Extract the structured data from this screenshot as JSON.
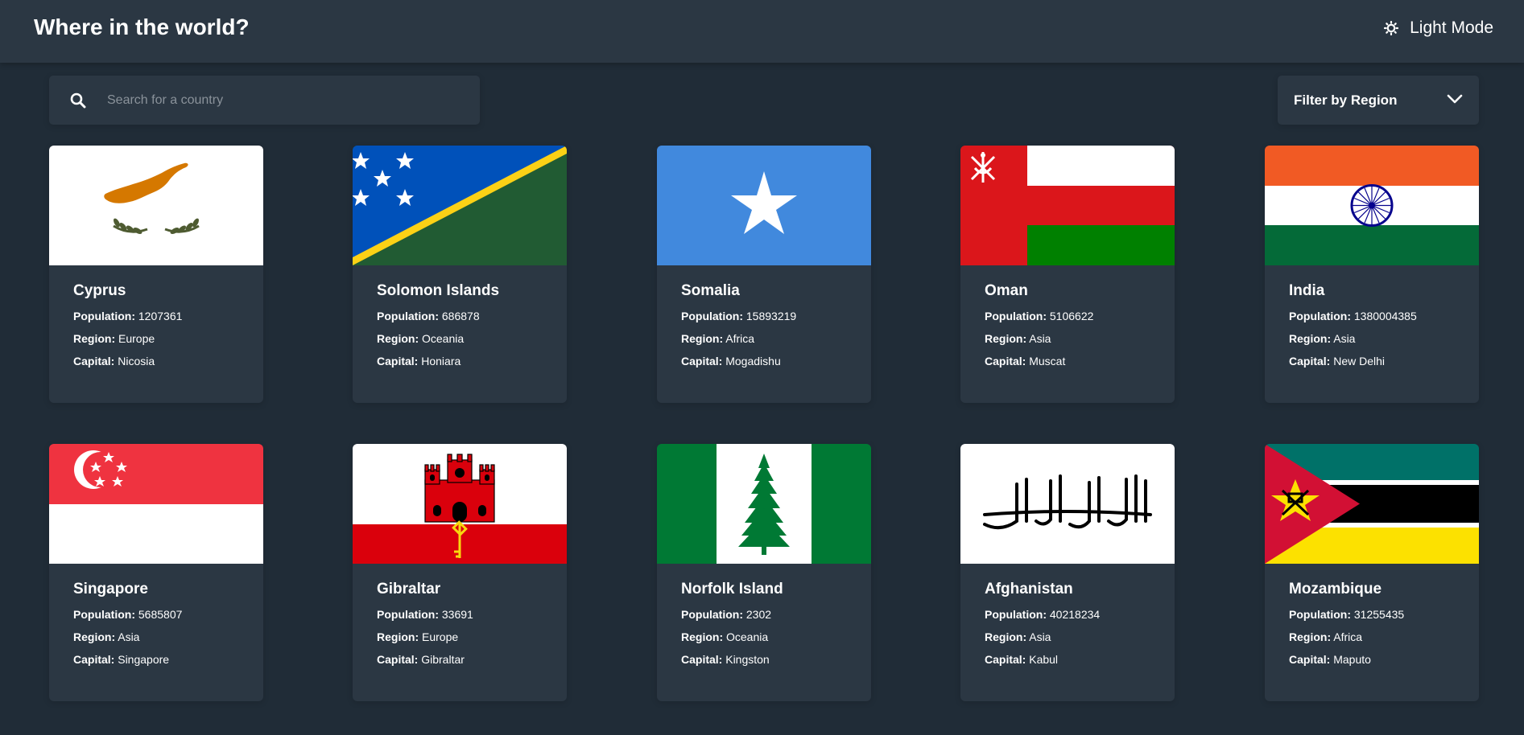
{
  "header": {
    "title": "Where in the world?",
    "theme_label": "Light Mode",
    "theme_icon": "sun-icon"
  },
  "search": {
    "placeholder": "Search for a country",
    "icon": "search-icon"
  },
  "filter": {
    "label": "Filter by Region",
    "icon": "chevron-down-icon"
  },
  "labels": {
    "population": "Population:",
    "region": "Region:",
    "capital": "Capital:"
  },
  "countries": [
    {
      "name": "Cyprus",
      "population": "1207361",
      "region": "Europe",
      "capital": "Nicosia",
      "flag": "cyprus-flag"
    },
    {
      "name": "Solomon Islands",
      "population": "686878",
      "region": "Oceania",
      "capital": "Honiara",
      "flag": "solomon-islands-flag"
    },
    {
      "name": "Somalia",
      "population": "15893219",
      "region": "Africa",
      "capital": "Mogadishu",
      "flag": "somalia-flag"
    },
    {
      "name": "Oman",
      "population": "5106622",
      "region": "Asia",
      "capital": "Muscat",
      "flag": "oman-flag"
    },
    {
      "name": "India",
      "population": "1380004385",
      "region": "Asia",
      "capital": "New Delhi",
      "flag": "india-flag"
    },
    {
      "name": "Singapore",
      "population": "5685807",
      "region": "Asia",
      "capital": "Singapore",
      "flag": "singapore-flag"
    },
    {
      "name": "Gibraltar",
      "population": "33691",
      "region": "Europe",
      "capital": "Gibraltar",
      "flag": "gibraltar-flag"
    },
    {
      "name": "Norfolk Island",
      "population": "2302",
      "region": "Oceania",
      "capital": "Kingston",
      "flag": "norfolk-island-flag"
    },
    {
      "name": "Afghanistan",
      "population": "40218234",
      "region": "Asia",
      "capital": "Kabul",
      "flag": "afghanistan-flag"
    },
    {
      "name": "Mozambique",
      "population": "31255435",
      "region": "Africa",
      "capital": "Maputo",
      "flag": "mozambique-flag"
    }
  ],
  "colors": {
    "background": "#202c37",
    "element": "#2b3743",
    "text": "#ffffff"
  }
}
